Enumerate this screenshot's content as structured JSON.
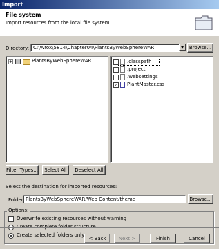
{
  "window": {
    "title": "Import"
  },
  "banner": {
    "title": "File system",
    "description": "Import resources from the local file system."
  },
  "directory": {
    "label": "Directory:",
    "value": "C:\\Wrox\\5814\\Chapter04\\PlantsByWebSphereWAR",
    "browse": "Browse..."
  },
  "tree": {
    "root": "PlantsByWebSphereWAR"
  },
  "files": [
    {
      "name": ".classpath",
      "checked": false
    },
    {
      "name": ".project",
      "checked": false
    },
    {
      "name": ".websettings",
      "checked": false
    },
    {
      "name": "PlantMaster.css",
      "checked": true
    }
  ],
  "buttons": {
    "filter": "Filter Types...",
    "select_all": "Select All",
    "deselect_all": "Deselect All"
  },
  "destination": {
    "prompt": "Select the destination for imported resources:",
    "label": "Folder:",
    "value": "PlantsByWebSphereWAR/Web Content/theme",
    "browse": "Browse..."
  },
  "options": {
    "title": "Options:",
    "items": [
      {
        "label": "Overwrite existing resources without warning",
        "type": "checkbox",
        "checked": false
      },
      {
        "label": "Create complete folder structure",
        "type": "radio",
        "checked": false
      },
      {
        "label": "Create selected folders only",
        "type": "radio",
        "checked": true
      }
    ]
  },
  "footer": {
    "back": "< Back",
    "next": "Next >",
    "finish": "Finish",
    "cancel": "Cancel"
  }
}
